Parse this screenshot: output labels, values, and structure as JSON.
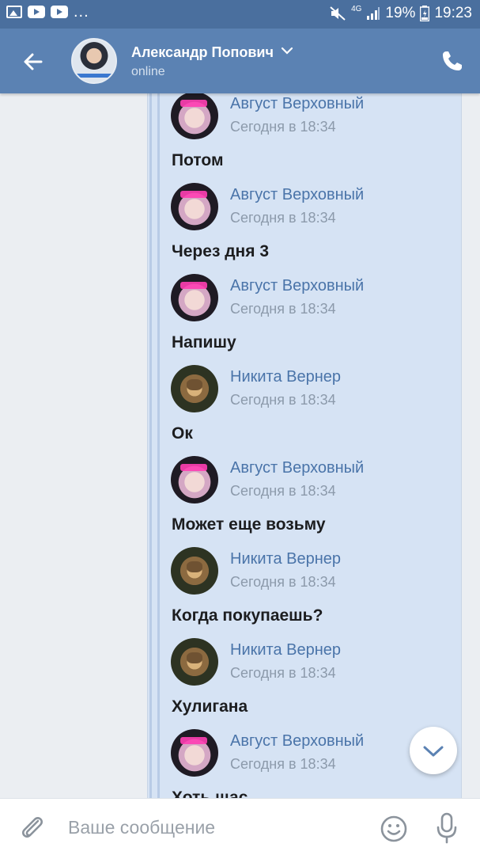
{
  "status_bar": {
    "battery": "19%",
    "time": "19:23",
    "network": "4G",
    "more": "..."
  },
  "header": {
    "name": "Александр Попович",
    "status": "online"
  },
  "messages": [
    {
      "author": "Август Верховный",
      "time": "Сегодня в 18:34",
      "text": "Потом",
      "avatar": "anime"
    },
    {
      "author": "Август Верховный",
      "time": "Сегодня в 18:34",
      "text": "Через дня 3",
      "avatar": "anime"
    },
    {
      "author": "Август Верховный",
      "time": "Сегодня в 18:34",
      "text": "Напишу",
      "avatar": "anime"
    },
    {
      "author": "Никита Вернер",
      "time": "Сегодня в 18:34",
      "text": "Ок",
      "avatar": "cat"
    },
    {
      "author": "Август Верховный",
      "time": "Сегодня в 18:34",
      "text": "Может еще возьму",
      "avatar": "anime"
    },
    {
      "author": "Никита Вернер",
      "time": "Сегодня в 18:34",
      "text": "Когда покупаешь?",
      "avatar": "cat"
    },
    {
      "author": "Никита Вернер",
      "time": "Сегодня в 18:34",
      "text": "Хулигана",
      "avatar": "cat"
    },
    {
      "author": "Август Верховный",
      "time": "Сегодня в 18:34",
      "text": "Хоть щас",
      "avatar": "anime"
    }
  ],
  "composer": {
    "placeholder": "Ваше сообщение"
  },
  "colors": {
    "status_bar": "#4a6f9e",
    "header": "#5b82b3",
    "forward_bg": "#d6e3f4",
    "author_link": "#4a74a9"
  },
  "icons": {
    "back": "arrow-left-icon",
    "dropdown": "chevron-down-icon",
    "call": "phone-icon",
    "attach": "paperclip-icon",
    "emoji": "smiley-icon",
    "voice": "microphone-icon",
    "scroll": "chevron-down-icon"
  }
}
